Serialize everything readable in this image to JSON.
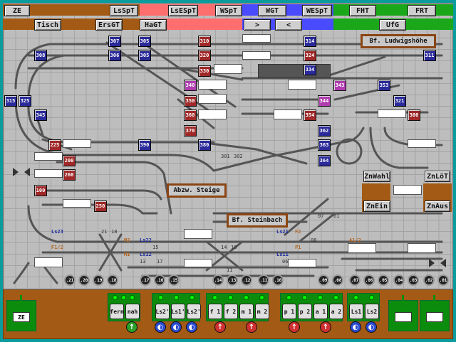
{
  "top_row1": [
    "ZE",
    "LsSpT",
    "LsESpT",
    "WSpT",
    "WGT",
    "WESpT",
    "FHT",
    "FRT"
  ],
  "top_row2": [
    "Tisch",
    "ErsGT",
    "HaGT",
    ">",
    "<",
    "UfG"
  ],
  "station_labels": [
    "Bf. Ludwigshöhe",
    "Abzw. Steige",
    "Bf. Steinbach"
  ],
  "side_buttons": [
    "ZnWahl",
    "ZnLöT",
    "ZnEin",
    "ZnAus"
  ],
  "signals": [
    {
      "id": "307",
      "c": "blue"
    },
    {
      "id": "306",
      "c": "blue"
    },
    {
      "id": "305",
      "c": "blue"
    },
    {
      "id": "305",
      "c": "blue"
    },
    {
      "id": "308",
      "c": "blue"
    },
    {
      "id": "310",
      "c": "red"
    },
    {
      "id": "320",
      "c": "red"
    },
    {
      "id": "330",
      "c": "red"
    },
    {
      "id": "340",
      "c": "pink"
    },
    {
      "id": "350",
      "c": "red"
    },
    {
      "id": "360",
      "c": "red"
    },
    {
      "id": "370",
      "c": "red"
    },
    {
      "id": "380",
      "c": "blue"
    },
    {
      "id": "390",
      "c": "blue"
    },
    {
      "id": "314",
      "c": "blue"
    },
    {
      "id": "324",
      "c": "red"
    },
    {
      "id": "334",
      "c": "blue"
    },
    {
      "id": "343",
      "c": "pink"
    },
    {
      "id": "344",
      "c": "pink"
    },
    {
      "id": "354",
      "c": "red"
    },
    {
      "id": "362",
      "c": "blue"
    },
    {
      "id": "363",
      "c": "blue"
    },
    {
      "id": "364",
      "c": "blue"
    },
    {
      "id": "311",
      "c": "blue"
    },
    {
      "id": "353",
      "c": "blue"
    },
    {
      "id": "321",
      "c": "blue"
    },
    {
      "id": "300",
      "c": "red"
    },
    {
      "id": "315",
      "c": "blue"
    },
    {
      "id": "325",
      "c": "blue"
    },
    {
      "id": "345",
      "c": "blue"
    },
    {
      "id": "225",
      "c": "red"
    },
    {
      "id": "200",
      "c": "red"
    },
    {
      "id": "260",
      "c": "red"
    },
    {
      "id": "100",
      "c": "red"
    },
    {
      "id": "250",
      "c": "red"
    }
  ],
  "track_labels": [
    "Ls23",
    "Ls22",
    "Ls12",
    "Ls21",
    "Ls11",
    "F1/2",
    "M2",
    "M1",
    "F2",
    "P1",
    "A1/2",
    "21",
    "18",
    "15",
    "14",
    "10",
    "08",
    "06",
    "07",
    "01",
    "301",
    "302",
    "13",
    "17",
    "11"
  ],
  "sections": [
    ".21",
    ".20",
    ".19",
    ".18",
    ".17",
    ".16",
    ".15",
    ".14",
    ".13",
    ".12",
    ".11",
    ".10",
    ".09",
    ".08",
    ".07",
    ".06",
    ".05",
    ".04",
    ".03",
    ".02",
    ".01"
  ],
  "bottom_groups": [
    {
      "labels": [
        "fern",
        "nah"
      ],
      "circles": [
        "↑"
      ],
      "circle_color": "#2aa02a"
    },
    {
      "labels": [
        "Ls2'",
        "Ls1'",
        "Ls2'"
      ],
      "circles": [
        "◐",
        "◐",
        "◐"
      ],
      "circle_color": "#2a4ad0"
    },
    {
      "labels": [
        "f 1",
        "f 2",
        "m 1",
        "m 2"
      ],
      "circles": [
        "↑",
        "↑"
      ],
      "circle_color": "#d03030"
    },
    {
      "labels": [
        "p 1",
        "p 2",
        "a 1",
        "a 2"
      ],
      "circles": [
        "↑",
        "↑"
      ],
      "circle_color": "#d03030"
    },
    {
      "labels": [
        "Ls1",
        "Ls2"
      ],
      "circles": [
        "◐",
        "◐"
      ],
      "circle_color": "#2a4ad0"
    }
  ],
  "ze_label": "ZE"
}
